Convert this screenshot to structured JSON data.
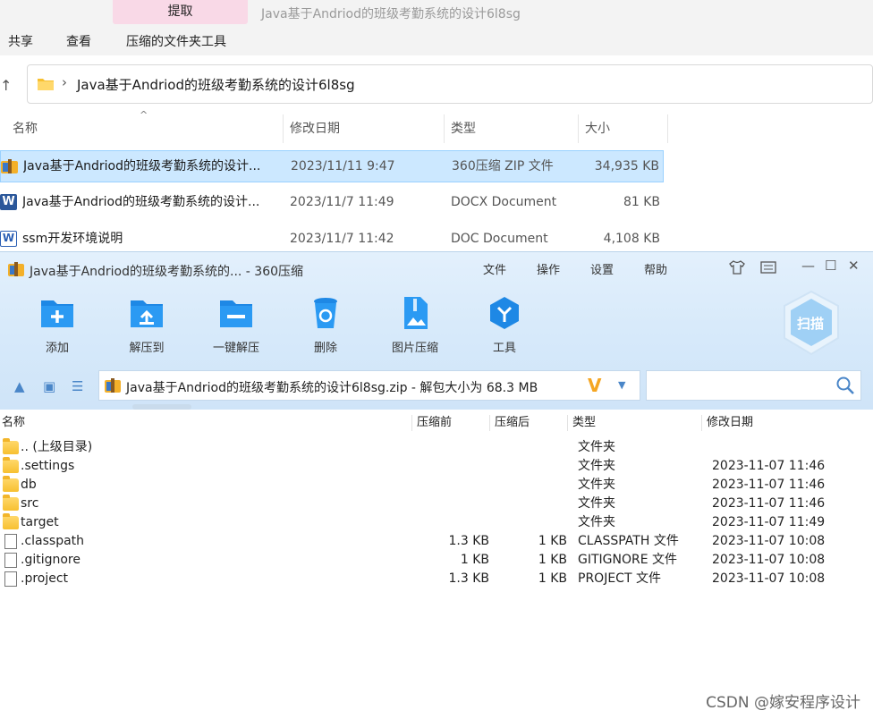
{
  "explorer": {
    "context_tab": "提取",
    "window_title": "Java基于Andriod的班级考勤系统的设计6l8sg",
    "ribbon_tabs": [
      "共享",
      "查看",
      "压缩的文件夹工具"
    ],
    "address_path": "Java基于Andriod的班级考勤系统的设计6l8sg",
    "columns": {
      "name": "名称",
      "modified": "修改日期",
      "type": "类型",
      "size": "大小"
    },
    "files": [
      {
        "icon": "zip-archive-icon",
        "name": "Java基于Andriod的班级考勤系统的设计...",
        "date": "2023/11/11 9:47",
        "type": "360压缩 ZIP 文件",
        "size": "34,935 KB",
        "selected": true
      },
      {
        "icon": "word-docx-icon",
        "name": "Java基于Andriod的班级考勤系统的设计...",
        "date": "2023/11/7 11:49",
        "type": "DOCX Document",
        "size": "81 KB",
        "selected": false
      },
      {
        "icon": "word-doc-icon",
        "name": "ssm开发环境说明",
        "date": "2023/11/7 11:42",
        "type": "DOC Document",
        "size": "4,108 KB",
        "selected": false
      }
    ]
  },
  "zip": {
    "title": "Java基于Andriod的班级考勤系统的... - 360压缩",
    "menu": [
      "文件",
      "操作",
      "设置",
      "帮助"
    ],
    "tools": [
      {
        "label": "添加",
        "icon": "add-folder-icon"
      },
      {
        "label": "解压到",
        "icon": "extract-to-icon"
      },
      {
        "label": "一键解压",
        "icon": "one-click-extract-icon"
      },
      {
        "label": "删除",
        "icon": "delete-bin-icon"
      },
      {
        "label": "图片压缩",
        "icon": "image-compress-icon"
      },
      {
        "label": "工具",
        "icon": "tools-icon"
      }
    ],
    "scan_label": "扫描",
    "path": "Java基于Andriod的班级考勤系统的设计6l8sg.zip - 解包大小为 68.3 MB",
    "columns": {
      "name": "名称",
      "before": "压缩前",
      "after": "压缩后",
      "type": "类型",
      "date": "修改日期"
    },
    "rows": [
      {
        "kind": "folder",
        "name": ".. (上级目录)",
        "before": "",
        "after": "",
        "type": "文件夹",
        "date": ""
      },
      {
        "kind": "folder",
        "name": ".settings",
        "before": "",
        "after": "",
        "type": "文件夹",
        "date": "2023-11-07 11:46"
      },
      {
        "kind": "folder",
        "name": "db",
        "before": "",
        "after": "",
        "type": "文件夹",
        "date": "2023-11-07 11:46"
      },
      {
        "kind": "folder",
        "name": "src",
        "before": "",
        "after": "",
        "type": "文件夹",
        "date": "2023-11-07 11:46"
      },
      {
        "kind": "folder",
        "name": "target",
        "before": "",
        "after": "",
        "type": "文件夹",
        "date": "2023-11-07 11:49"
      },
      {
        "kind": "file",
        "name": ".classpath",
        "before": "1.3 KB",
        "after": "1 KB",
        "type": "CLASSPATH 文件",
        "date": "2023-11-07 10:08"
      },
      {
        "kind": "file",
        "name": ".gitignore",
        "before": "1 KB",
        "after": "1 KB",
        "type": "GITIGNORE 文件",
        "date": "2023-11-07 10:08"
      },
      {
        "kind": "file",
        "name": ".project",
        "before": "1.3 KB",
        "after": "1 KB",
        "type": "PROJECT 文件",
        "date": "2023-11-07 10:08"
      }
    ]
  },
  "watermark": "CSDN @嫁安程序设计",
  "colors": {
    "selection": "#cce8ff",
    "zip_header": "#d6e9fa",
    "accent_blue": "#1e88e5",
    "folder": "#f7c030"
  }
}
